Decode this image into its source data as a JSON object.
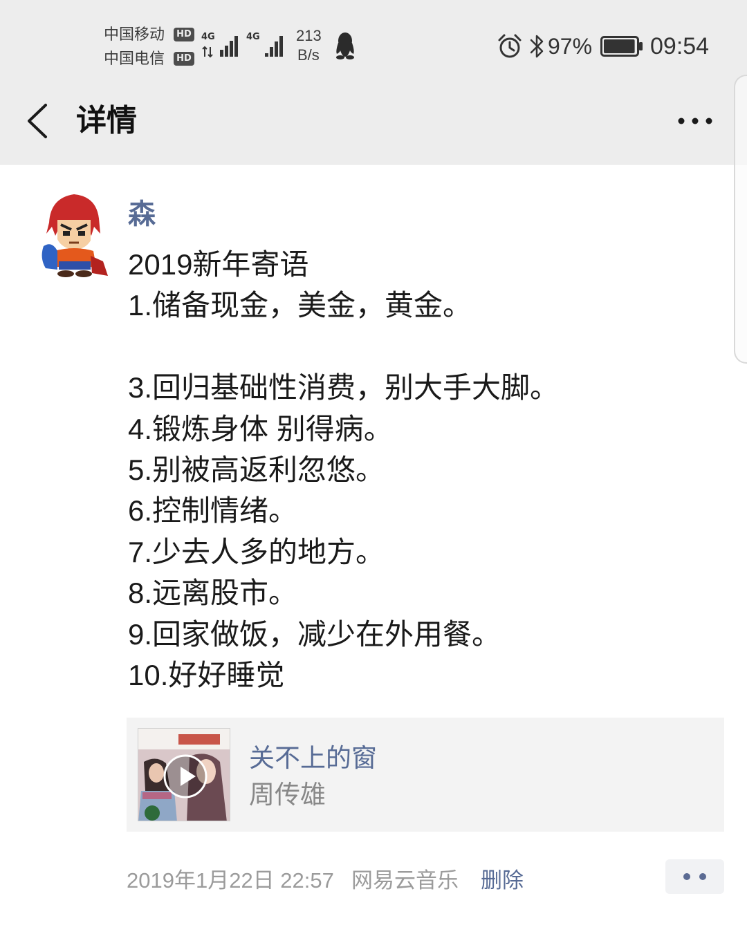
{
  "status_bar": {
    "carriers": [
      "中国移动",
      "中国电信"
    ],
    "hd_badge": "HD",
    "signals": [
      {
        "network": "4G",
        "level": 4
      },
      {
        "network": "4G",
        "level": 4
      }
    ],
    "speed_value": "213",
    "speed_unit": "B/s",
    "battery_percent": "97%",
    "battery_level": 0.97,
    "time": "09:54",
    "icons": {
      "data_activity": "up-down-arrows-icon",
      "qq": "qq-penguin-icon",
      "alarm": "alarm-clock-icon",
      "bluetooth": "bluetooth-icon",
      "battery": "battery-icon"
    }
  },
  "header": {
    "title": "详情",
    "back_icon": "back-chevron-icon",
    "more_icon": "more-dots-icon"
  },
  "post": {
    "author": "森",
    "avatar_icon": "cartoon-avatar",
    "lines": [
      "2019新年寄语",
      "1.储备现金，美金，黄金。",
      "",
      "3.回归基础性消费，别大手大脚。",
      "4.锻炼身体 别得病。",
      "5.别被高返利忽悠。",
      "6.控制情绪。",
      "7.少去人多的地方。",
      "8.远离股市。",
      "9.回家做饭，减少在外用餐。",
      "10.好好睡觉"
    ],
    "music": {
      "title": "关不上的窗",
      "artist": "周传雄",
      "cover_icon": "album-cover",
      "play_icon": "play-icon"
    },
    "timestamp": "2019年1月22日 22:57",
    "source": "网易云音乐",
    "delete_label": "删除",
    "comment_icon": "comment-dots-icon"
  },
  "colors": {
    "top_bar_background": "#ededed",
    "link_blue": "#576b95",
    "body_text": "#1a1a1a",
    "meta_text": "#9b9b9b",
    "card_background": "#f3f3f3"
  }
}
